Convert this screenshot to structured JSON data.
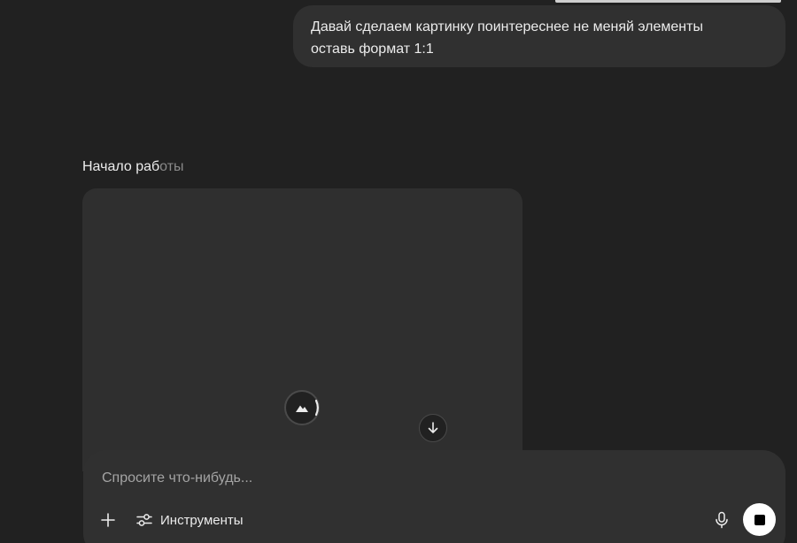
{
  "conversation": {
    "user_message": {
      "line1": "Давай сделаем картинку поинтереснее не меняй элементы",
      "line2": "оставь формат 1:1"
    },
    "assistant": {
      "status_lead": "Начало раб",
      "status_trail": "оты",
      "image_state": "generating"
    }
  },
  "composer": {
    "placeholder": "Спросите что-нибудь...",
    "value": "",
    "tools_label": "Инструменты"
  },
  "icons": {
    "add": "plus-icon",
    "tools": "sliders-icon",
    "mic": "microphone-icon",
    "stop": "stop-icon",
    "scroll": "arrow-down-icon",
    "image": "image-icon"
  },
  "colors": {
    "background": "#212121",
    "surface": "#303030",
    "card": "#2f2f2f",
    "text": "#ececec",
    "muted_text": "#8a8a8a",
    "stop_button": "#ffffff"
  }
}
